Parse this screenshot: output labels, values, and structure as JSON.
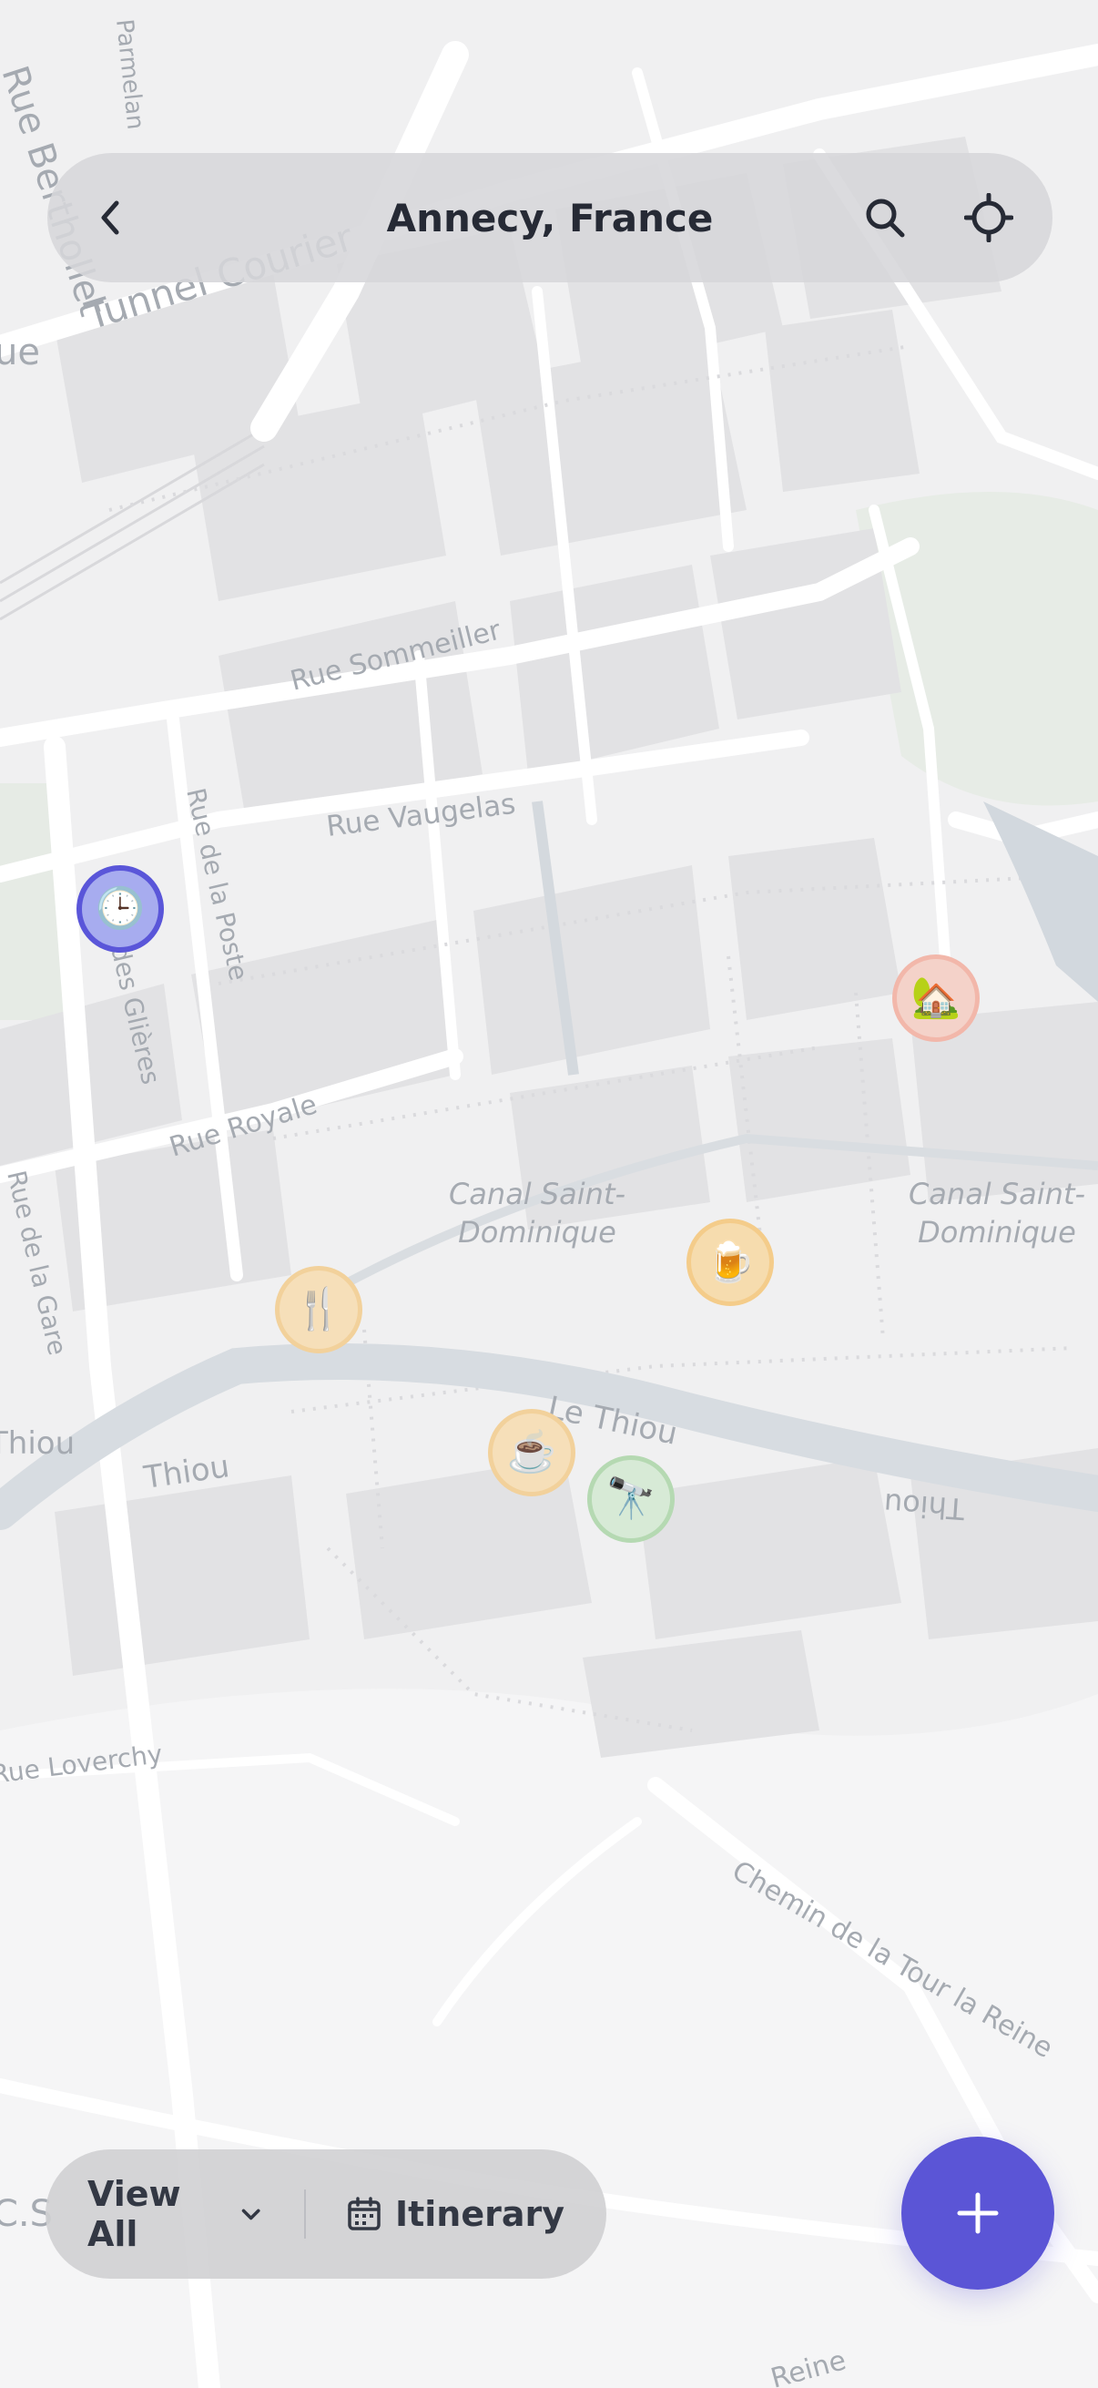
{
  "header": {
    "title": "Annecy, France",
    "back_icon": "chevron-left-icon",
    "search_icon": "search-icon",
    "locate_icon": "crosshair-icon"
  },
  "map": {
    "street_labels": [
      "Tunnel Courier",
      "Rue Sommeiller",
      "Rue Vaugelas",
      "Rue de la Poste",
      "Rue des Glières",
      "Rue Royale",
      "Rue de la Gare",
      "Le Thiou",
      "Thiou",
      "Thiou",
      "Thiou",
      "Rue Loverchy",
      "Chemin de la Tour la Reine",
      "Rue Berthollet",
      "Parmelan",
      "Rue",
      "C.S",
      "Reine"
    ],
    "canal_labels": {
      "canal_1_line1": "Canal Saint-",
      "canal_1_line2": "Dominique",
      "canal_2_line1": "Canal Saint-",
      "canal_2_line2": "Dominique"
    }
  },
  "markers": {
    "clock": {
      "emoji": "🕒",
      "icon": "clock-icon",
      "color": "#5a56d9"
    },
    "house": {
      "emoji": "🏡",
      "icon": "house-icon",
      "color": "#f2b7aa"
    },
    "beer": {
      "emoji": "🍺",
      "icon": "beer-icon",
      "color": "#f4cc8a"
    },
    "restaurant": {
      "emoji": "🍴",
      "icon": "fork-knife-icon",
      "color": "#f2d19b"
    },
    "coffee": {
      "emoji": "☕",
      "icon": "coffee-icon",
      "color": "#f2d19b"
    },
    "telescope": {
      "emoji": "🔭",
      "icon": "telescope-icon",
      "color": "#b5d9b2"
    }
  },
  "bottom_bar": {
    "view_all_label": "View All",
    "view_all_icon": "chevron-down-icon",
    "itinerary_label": "Itinerary",
    "itinerary_icon": "calendar-icon"
  },
  "fab": {
    "icon": "plus-icon",
    "color": "#5b55d6"
  }
}
